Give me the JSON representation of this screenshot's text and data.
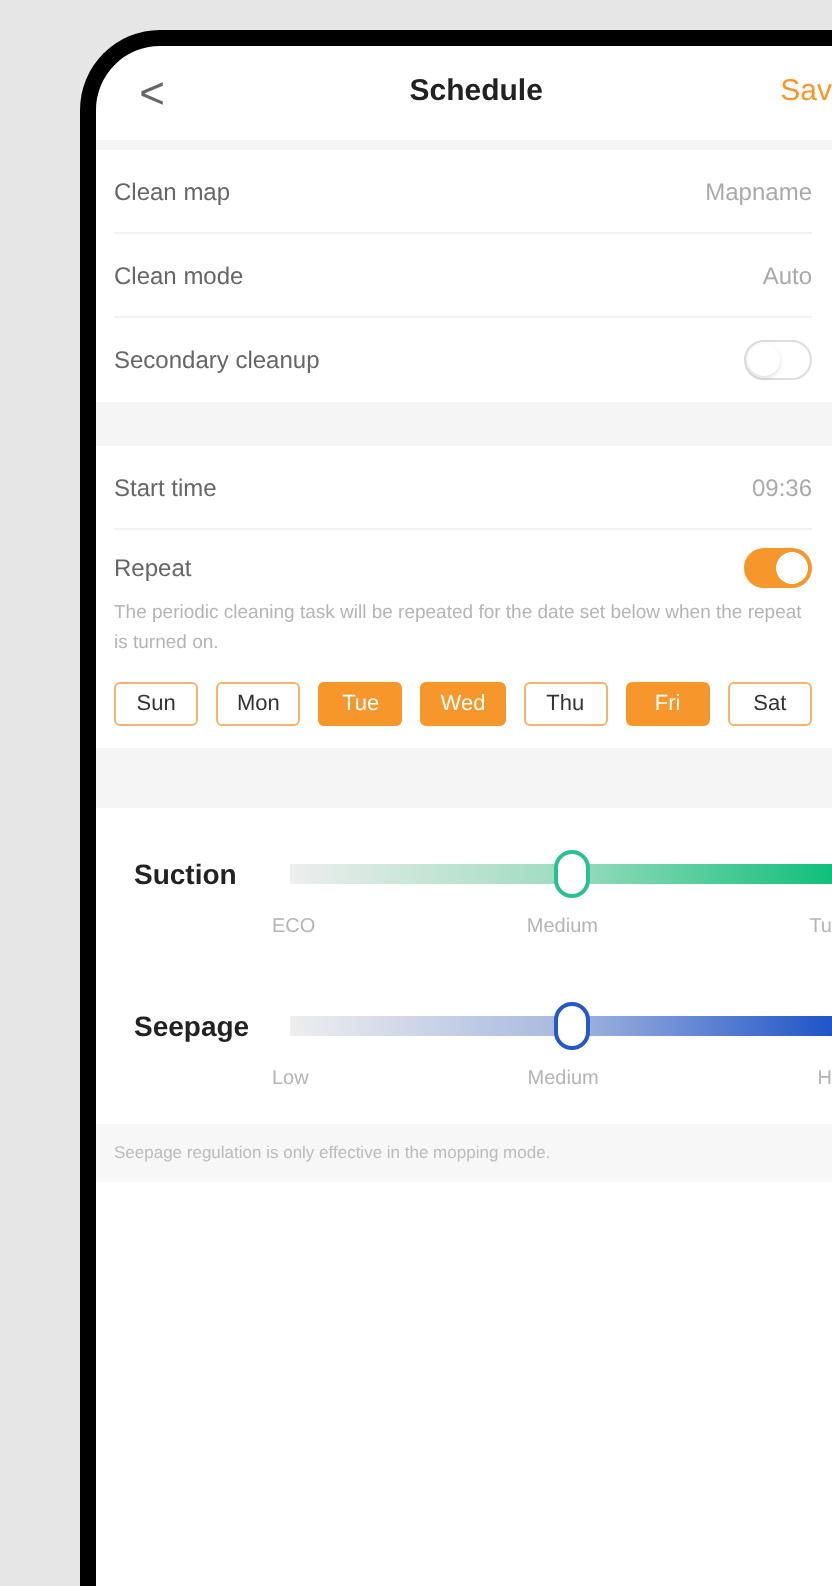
{
  "header": {
    "back": "<",
    "title": "Schedule",
    "action": "Sav"
  },
  "settings": [
    {
      "kind": "value",
      "label": "Clean map",
      "value": "Mapname"
    },
    {
      "kind": "value",
      "label": "Clean mode",
      "value": "Auto"
    },
    {
      "kind": "toggle",
      "label": "Secondary cleanup",
      "on": false
    }
  ],
  "timing": {
    "start_label": "Start time",
    "start_value": "09:36",
    "repeat_label": "Repeat",
    "repeat_on": true,
    "note": "The periodic cleaning task will be repeated for the date set below when the repeat is turned on."
  },
  "days": [
    {
      "label": "Sun",
      "selected": false
    },
    {
      "label": "Mon",
      "selected": false
    },
    {
      "label": "Tue",
      "selected": true
    },
    {
      "label": "Wed",
      "selected": true
    },
    {
      "label": "Thu",
      "selected": false
    },
    {
      "label": "Fri",
      "selected": true
    },
    {
      "label": "Sat",
      "selected": false
    }
  ],
  "sliders": [
    {
      "kind": "suction",
      "label": "Suction",
      "level": 0.52,
      "ticks": [
        "ECO",
        "Medium",
        "Tu"
      ]
    },
    {
      "kind": "seepage",
      "label": "Seepage",
      "level": 0.52,
      "ticks": [
        "Low",
        "Medium",
        "H"
      ]
    }
  ],
  "footnote": "Seepage regulation is only effective in the mopping mode."
}
